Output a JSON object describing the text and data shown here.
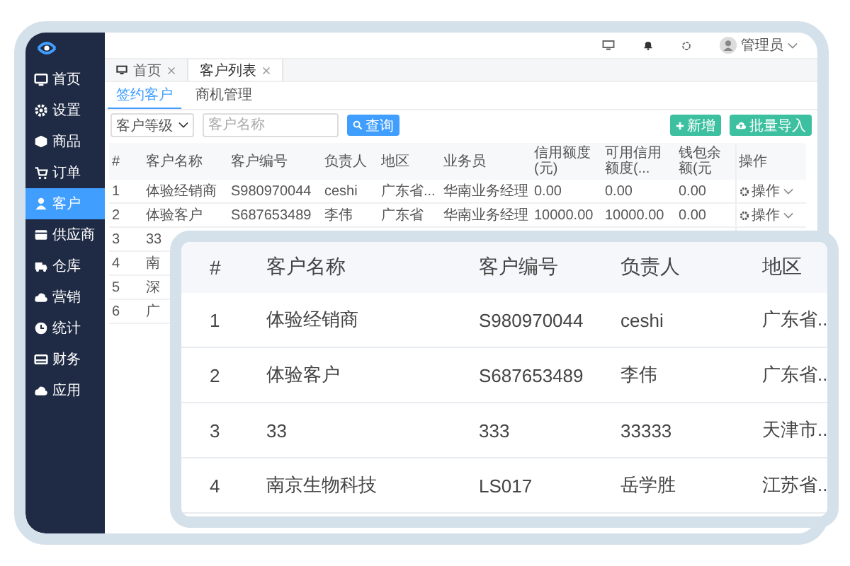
{
  "sidebar": {
    "items": [
      {
        "label": "首页",
        "selected": false
      },
      {
        "label": "设置",
        "selected": false
      },
      {
        "label": "商品",
        "selected": false
      },
      {
        "label": "订单",
        "selected": false
      },
      {
        "label": "客户",
        "selected": true
      },
      {
        "label": "供应商",
        "selected": false
      },
      {
        "label": "仓库",
        "selected": false
      },
      {
        "label": "营销",
        "selected": false
      },
      {
        "label": "统计",
        "selected": false
      },
      {
        "label": "财务",
        "selected": false
      },
      {
        "label": "应用",
        "selected": false
      }
    ]
  },
  "header": {
    "user": "管理员"
  },
  "tabs": [
    {
      "label": "首页",
      "selected": false
    },
    {
      "label": "客户列表",
      "selected": true
    }
  ],
  "subtabs": [
    {
      "label": "签约客户",
      "selected": true
    },
    {
      "label": "商机管理",
      "selected": false
    }
  ],
  "filter": {
    "level_select": "客户等级",
    "name_field": {
      "placeholder": "客户名称"
    },
    "search_button": "查询"
  },
  "actions": [
    "新增",
    "批量导入"
  ],
  "table": {
    "columns": [
      "#",
      "客户名称",
      "客户编号",
      "负责人",
      "地区",
      "业务员",
      "信用额度(元)",
      "可用信用额度(...",
      "钱包余额(元",
      "操作"
    ],
    "rows": [
      {
        "cells": [
          "1",
          "体验经销商",
          "S980970044",
          "ceshi",
          "广东省...",
          "华南业务经理",
          "0.00",
          "0.00",
          "0.00"
        ],
        "operation": "操作"
      },
      {
        "cells": [
          "2",
          "体验客户",
          "S687653489",
          "李伟",
          "广东省",
          "华南业务经理",
          "10000.00",
          "10000.00",
          "0.00"
        ],
        "operation": "操作"
      },
      {
        "cells": [
          "3",
          "33"
        ]
      },
      {
        "cells": [
          "4",
          "南"
        ]
      },
      {
        "cells": [
          "5",
          "深"
        ]
      },
      {
        "cells": [
          "6",
          "广"
        ]
      }
    ]
  },
  "zoom_table": {
    "columns": [
      "#",
      "客户名称",
      "客户编号",
      "负责人",
      "地区"
    ],
    "rows": [
      [
        "1",
        "体验经销商",
        "S980970044",
        "ceshi",
        "广东省..."
      ],
      [
        "2",
        "体验客户",
        "S687653489",
        "李伟",
        "广东省..."
      ],
      [
        "3",
        "33",
        "333",
        "33333",
        "天津市..."
      ],
      [
        "4",
        "南京生物科技",
        "LS017",
        "岳学胜",
        "江苏省..."
      ]
    ]
  }
}
